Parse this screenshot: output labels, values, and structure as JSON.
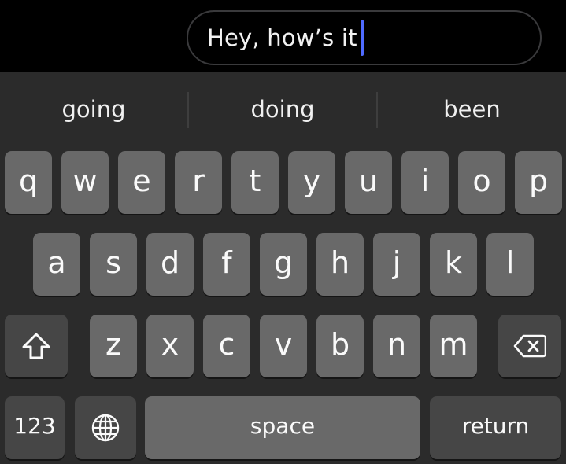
{
  "text_field": {
    "value": "Hey, how’s it"
  },
  "suggestions": [
    "going",
    "doing",
    "been"
  ],
  "keys": {
    "row1": [
      "q",
      "w",
      "e",
      "r",
      "t",
      "y",
      "u",
      "i",
      "o",
      "p"
    ],
    "row2": [
      "a",
      "s",
      "d",
      "f",
      "g",
      "h",
      "j",
      "k",
      "l"
    ],
    "row3": [
      "z",
      "x",
      "c",
      "v",
      "b",
      "n",
      "m"
    ],
    "numbers_label": "123",
    "space_label": "space",
    "return_label": "return"
  },
  "icons": {
    "shift": "shift-icon",
    "delete": "backspace-icon",
    "globe": "globe-icon"
  },
  "colors": {
    "caret": "#4f6bff",
    "keyboard_bg": "#2b2b2b",
    "letter_key": "#696969",
    "function_key": "#464646"
  }
}
